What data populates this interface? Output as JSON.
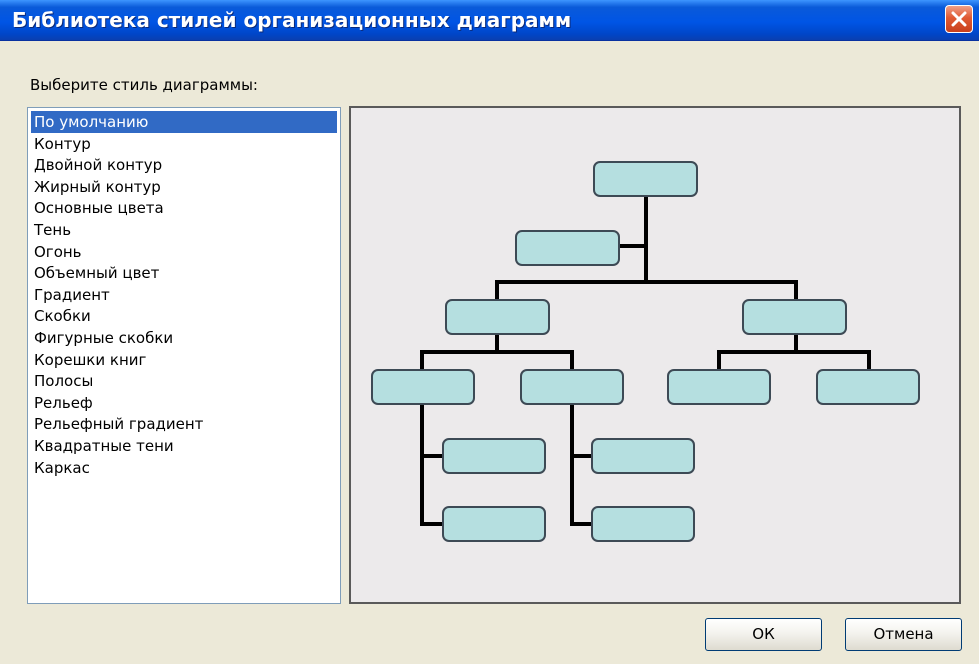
{
  "window": {
    "title": "Библиотека стилей организационных диаграмм"
  },
  "prompt_label": "Выберите стиль диаграммы:",
  "styles": [
    {
      "label": "По умолчанию",
      "selected": true
    },
    {
      "label": "Контур"
    },
    {
      "label": "Двойной контур"
    },
    {
      "label": "Жирный контур"
    },
    {
      "label": "Основные цвета"
    },
    {
      "label": "Тень"
    },
    {
      "label": "Огонь"
    },
    {
      "label": "Объемный цвет"
    },
    {
      "label": "Градиент"
    },
    {
      "label": "Скобки"
    },
    {
      "label": "Фигурные скобки"
    },
    {
      "label": "Корешки книг"
    },
    {
      "label": "Полосы"
    },
    {
      "label": "Рельеф"
    },
    {
      "label": "Рельефный градиент"
    },
    {
      "label": "Квадратные тени"
    },
    {
      "label": "Каркас"
    }
  ],
  "buttons": {
    "ok_label": "ОК",
    "cancel_label": "Отмена"
  },
  "colors": {
    "title_bar": "#0055e5",
    "selection": "#316ac5",
    "node_fill": "#b5dfe0",
    "node_border": "#3d4a55",
    "connector": "#000000",
    "preview_bg": "#eceaeb"
  },
  "icons": {
    "close": "close-x-icon"
  }
}
